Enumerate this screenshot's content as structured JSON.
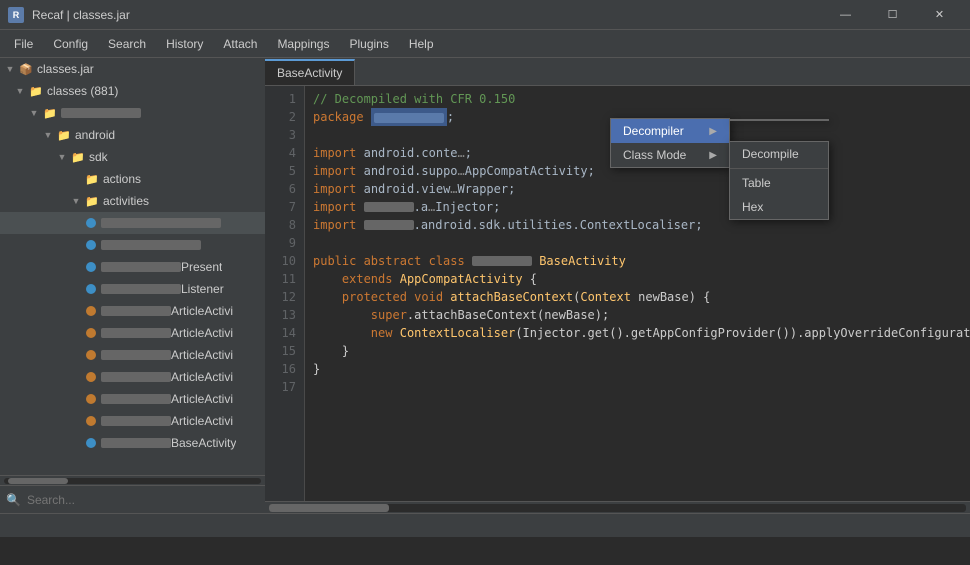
{
  "titlebar": {
    "icon_text": "R",
    "title": "Recaf | classes.jar",
    "minimize": "—",
    "maximize": "☐",
    "close": "✕"
  },
  "menubar": {
    "items": [
      "File",
      "Config",
      "Search",
      "History",
      "Attach",
      "Mappings",
      "Plugins",
      "Help"
    ]
  },
  "sidebar": {
    "root_label": "classes.jar",
    "classes_label": "classes (881)",
    "search_placeholder": "Search..."
  },
  "tabs": [
    {
      "label": "BaseActivity"
    }
  ],
  "context_menu": {
    "decompiler_label": "Decompiler",
    "class_mode_label": "Class Mode",
    "decompile_label": "Decompile",
    "table_label": "Table",
    "hex_label": "Hex"
  },
  "code": {
    "lines": [
      {
        "num": 1,
        "text": "// Decompiled with CFR 0.150",
        "type": "comment"
      },
      {
        "num": 2,
        "text": "package REDACTED;",
        "type": "pkg"
      },
      {
        "num": 3,
        "text": "",
        "type": "plain"
      },
      {
        "num": 4,
        "text": "import android.conte…;",
        "type": "import"
      },
      {
        "num": 5,
        "text": "import android.suppo…AppCompatActivity;",
        "type": "import"
      },
      {
        "num": 6,
        "text": "import android.view…Wrapper;",
        "type": "import"
      },
      {
        "num": 7,
        "text": "import REDACTED.a…Injector;",
        "type": "import"
      },
      {
        "num": 8,
        "text": "import REDACTED.android.sdk.utilities.ContextLocaliser;",
        "type": "import"
      },
      {
        "num": 9,
        "text": "",
        "type": "plain"
      },
      {
        "num": 10,
        "text": "public abstract class REDACTED BaseActivity",
        "type": "class"
      },
      {
        "num": 11,
        "text": "    extends AppCompatActivity {",
        "type": "plain"
      },
      {
        "num": 12,
        "text": "    protected void attachBaseContext(Context newBase) {",
        "type": "method"
      },
      {
        "num": 13,
        "text": "        super.attachBaseContext(newBase);",
        "type": "plain"
      },
      {
        "num": 14,
        "text": "        new ContextLocaliser(Injector.get().getAppConfigProvider()).applyOverrideConfiguratio…",
        "type": "plain"
      },
      {
        "num": 15,
        "text": "    }",
        "type": "plain"
      },
      {
        "num": 16,
        "text": "}",
        "type": "plain"
      },
      {
        "num": 17,
        "text": "",
        "type": "plain"
      }
    ]
  },
  "statusbar": {
    "text": ""
  }
}
